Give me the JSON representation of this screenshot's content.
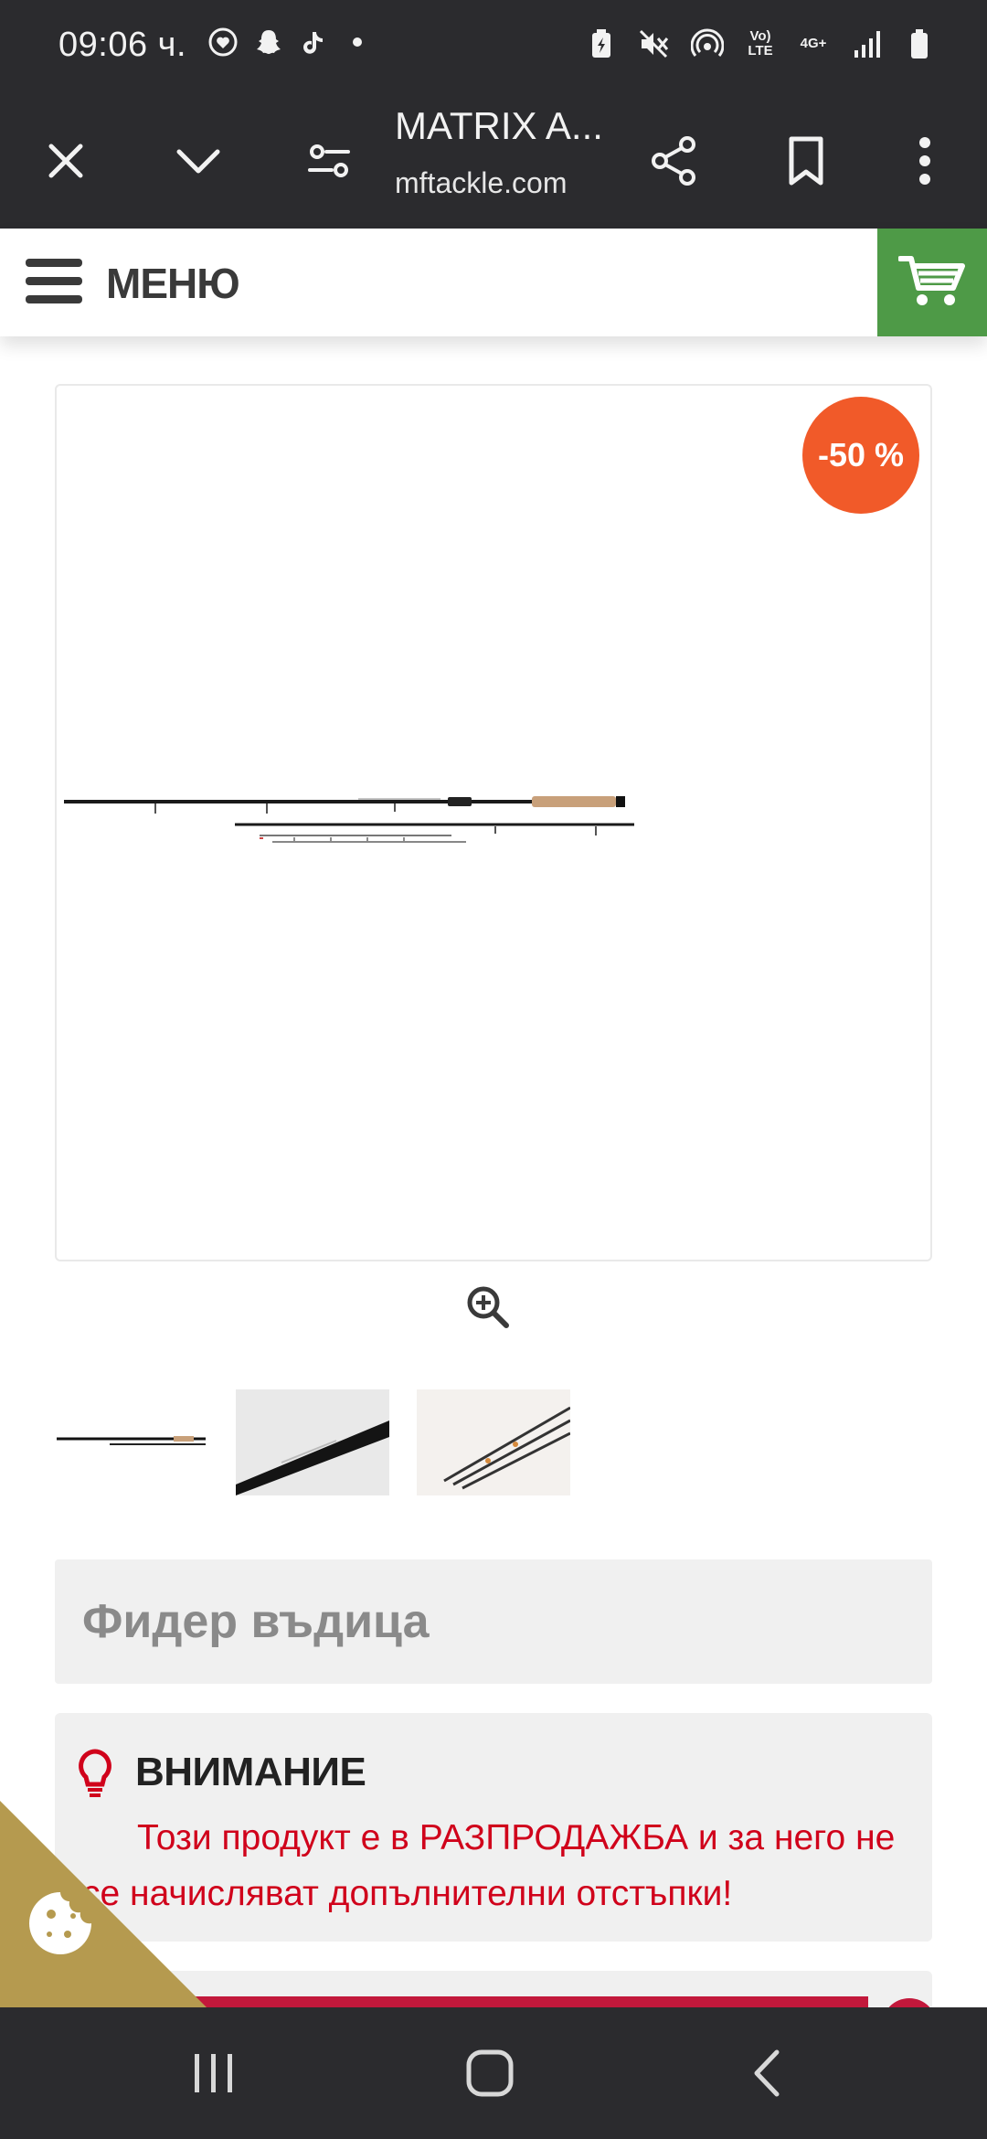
{
  "status_bar": {
    "time": "09:06 ч.",
    "left_icons": [
      "heart-circle-icon",
      "snapchat-ghost-icon",
      "tiktok-icon",
      "notification-dot-icon"
    ],
    "right_icons": [
      "battery-saver-icon",
      "mute-icon",
      "hotspot-icon",
      "volte-icon",
      "network-4g-icon",
      "signal-icon",
      "battery-icon"
    ],
    "volte_label": "Vo) LTE",
    "network_label": "4G+"
  },
  "toolbar": {
    "title": "MATRIX A...",
    "url": "mftackle.com",
    "icons": [
      "close-icon",
      "chevron-down-icon",
      "site-settings-icon",
      "share-icon",
      "bookmark-icon",
      "more-vertical-icon"
    ]
  },
  "header": {
    "menu_label": "МЕНЮ",
    "cart_icon": "cart-icon",
    "cart_color": "#4e9a47"
  },
  "product": {
    "discount_badge": "-50 %",
    "badge_color": "#f15a29",
    "image_desc_icon": "fishing-rod-image",
    "thumbnails": [
      "thumbnail-rod-full",
      "thumbnail-rod-detail",
      "thumbnail-rod-tips"
    ],
    "subtitle": "Фидер въдица"
  },
  "notice": {
    "title": "ВНИМАНИЕ",
    "text": "Този продукт е в РАЗПРОДАЖБА и за него не се начисляват допълнителни отстъпки!",
    "text_color": "#d0021b"
  },
  "cookie": {
    "icon": "cookie-icon",
    "color": "#b59a4f"
  },
  "nav_bar": {
    "icons": [
      "recent-apps-icon",
      "home-icon",
      "back-icon"
    ]
  }
}
